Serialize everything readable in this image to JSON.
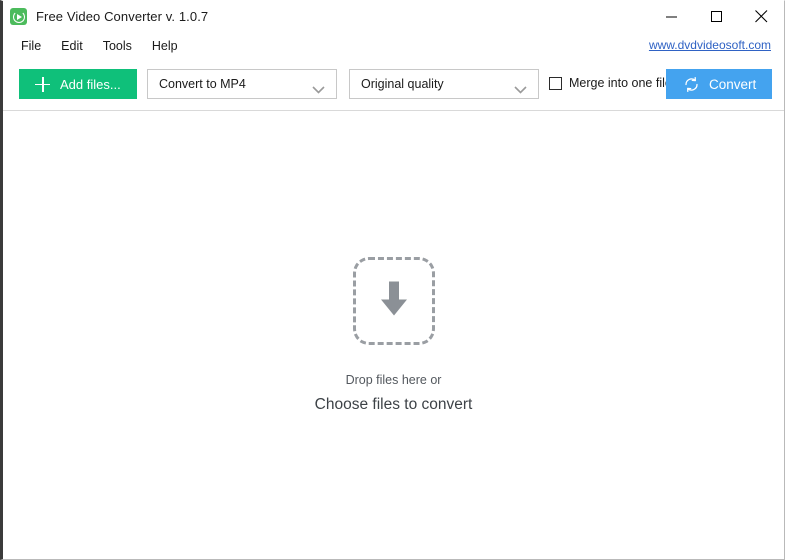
{
  "window": {
    "title": "Free Video Converter v. 1.0.7",
    "app_icon": "video-converter-icon",
    "controls": {
      "minimize": "minimize-icon",
      "maximize": "maximize-icon",
      "close": "close-icon"
    }
  },
  "menu": {
    "items": [
      {
        "label": "File"
      },
      {
        "label": "Edit"
      },
      {
        "label": "Tools"
      },
      {
        "label": "Help"
      }
    ],
    "site_link": "www.dvdvideosoft.com"
  },
  "toolbar": {
    "add_files_label": "Add files...",
    "add_files_icon": "plus-icon",
    "format_select": {
      "value": "Convert to MP4",
      "chevron": "chevron-down-icon"
    },
    "quality_select": {
      "value": "Original quality",
      "chevron": "chevron-down-icon"
    },
    "merge_checkbox": {
      "label": "Merge into one file",
      "checked": false
    },
    "convert_label": "Convert",
    "convert_icon": "refresh-circle-icon"
  },
  "dropzone": {
    "icon": "download-arrow-icon",
    "line1": "Drop files here or",
    "line2": "Choose files to convert"
  },
  "colors": {
    "accent_green": "#0fc07a",
    "accent_blue": "#44a3ef",
    "link_blue": "#2f62c4",
    "icon_green": "#4cbb5c",
    "dropzone_gray": "#9a9ea3"
  }
}
